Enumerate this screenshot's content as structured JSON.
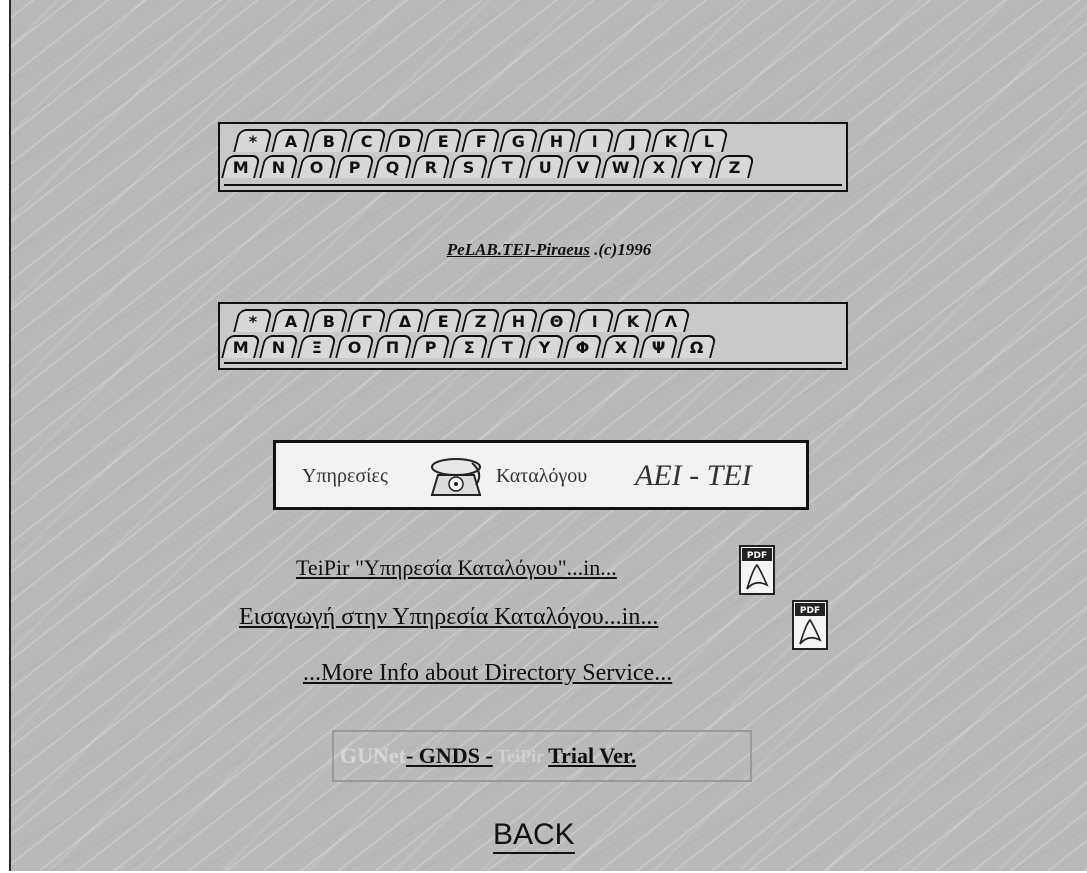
{
  "latin_tabs": {
    "row1": [
      "*",
      "A",
      "B",
      "C",
      "D",
      "E",
      "F",
      "G",
      "H",
      "I",
      "J",
      "K",
      "L"
    ],
    "row2": [
      "M",
      "N",
      "O",
      "P",
      "Q",
      "R",
      "S",
      "T",
      "U",
      "V",
      "W",
      "X",
      "Y",
      "Z"
    ]
  },
  "copyright": {
    "link": "PeLAB.TEI-Piraeus",
    "suffix": " .(c)1996"
  },
  "greek_tabs": {
    "row1": [
      "*",
      "Α",
      "Β",
      "Γ",
      "Δ",
      "Ε",
      "Ζ",
      "Η",
      "Θ",
      "Ι",
      "Κ",
      "Λ"
    ],
    "row2": [
      "Μ",
      "Ν",
      "Ξ",
      "Ο",
      "Π",
      "Ρ",
      "Σ",
      "Τ",
      "Υ",
      "Φ",
      "Χ",
      "Ψ",
      "Ω"
    ]
  },
  "banner": {
    "left": "Υπηρεσίες",
    "middle": "Καταλόγου",
    "right": "ΑΕΙ - ΤΕΙ",
    "icon": "telephone-icon"
  },
  "links": {
    "teipir_doc": "TeiPir \"Υπηρεσία Καταλόγου\"...in...",
    "intro_doc": "Εισαγωγή στην Υπηρεσία Καταλόγου...in...",
    "more_info": "...More Info about Directory Service..."
  },
  "pdf_icon": {
    "label": "PDF",
    "name": "pdf-icon"
  },
  "footer_bar": {
    "gunet": "GUNet",
    "gnds": "- GNDS -",
    "teipir": "TeiPir",
    "trial": "Trial Ver."
  },
  "back": "BACK",
  "colors": {
    "background": "#b9b9b9",
    "panel": "#c9c9c9",
    "text": "#111111"
  }
}
